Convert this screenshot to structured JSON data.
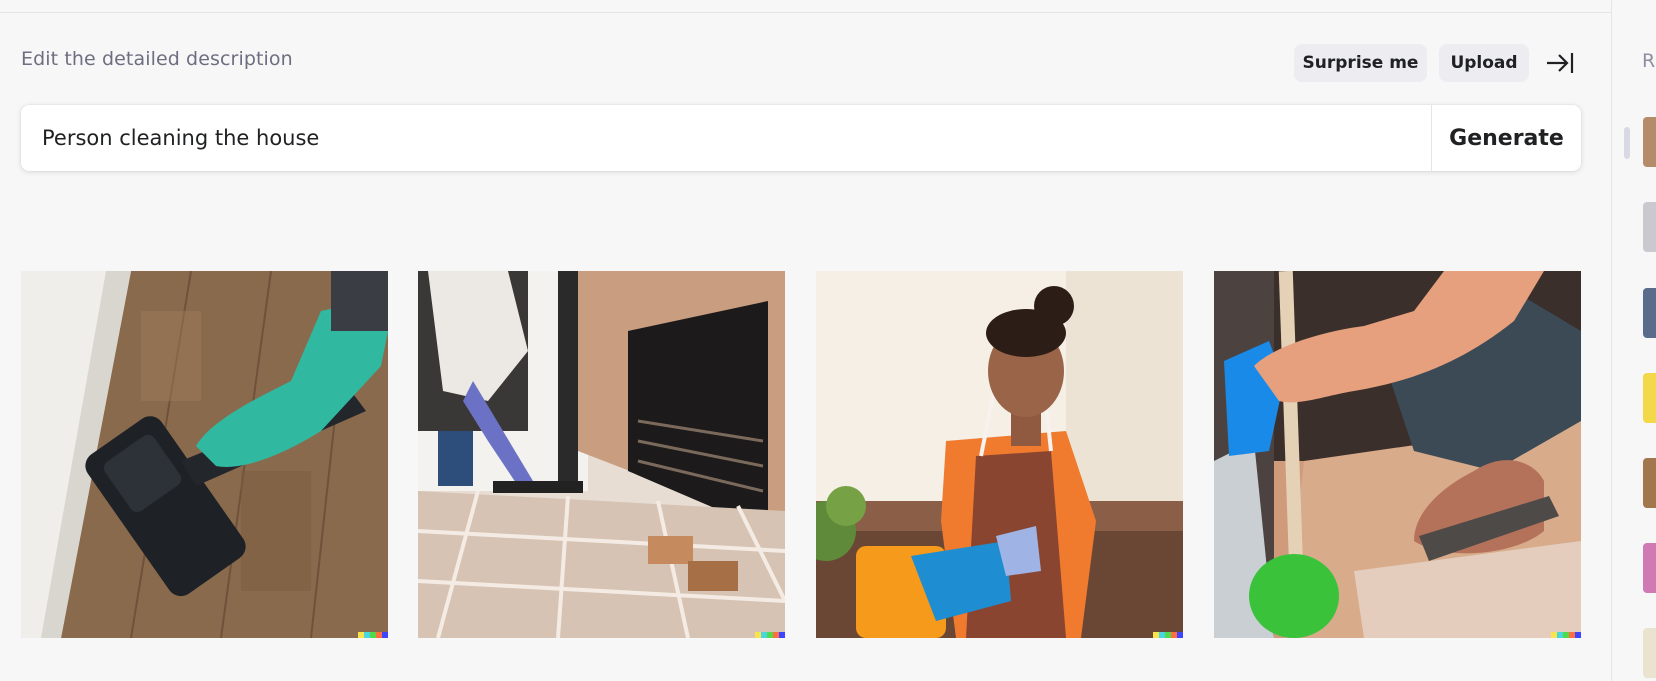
{
  "header": {
    "description_label": "Edit the detailed description",
    "surprise_label": "Surprise me",
    "upload_label": "Upload"
  },
  "prompt": {
    "value": "Person cleaning the house",
    "generate_label": "Generate"
  },
  "images": [
    {
      "name": "vacuum-floor-image",
      "subject": "Gloved hand vacuuming wood floor"
    },
    {
      "name": "mopping-tiles-image",
      "subject": "Person mopping tiled floor by fireplace"
    },
    {
      "name": "woman-apron-image",
      "subject": "Woman in apron holding cleaning cloth"
    },
    {
      "name": "brush-sandals-image",
      "subject": "Hand scrubbing floor with green brush"
    }
  ],
  "right_panel": {
    "title_initial": "R"
  },
  "colors": {
    "background": "#f7f7f8",
    "button_bg": "#ececf1",
    "text": "#202123",
    "muted": "#6e6e80"
  }
}
